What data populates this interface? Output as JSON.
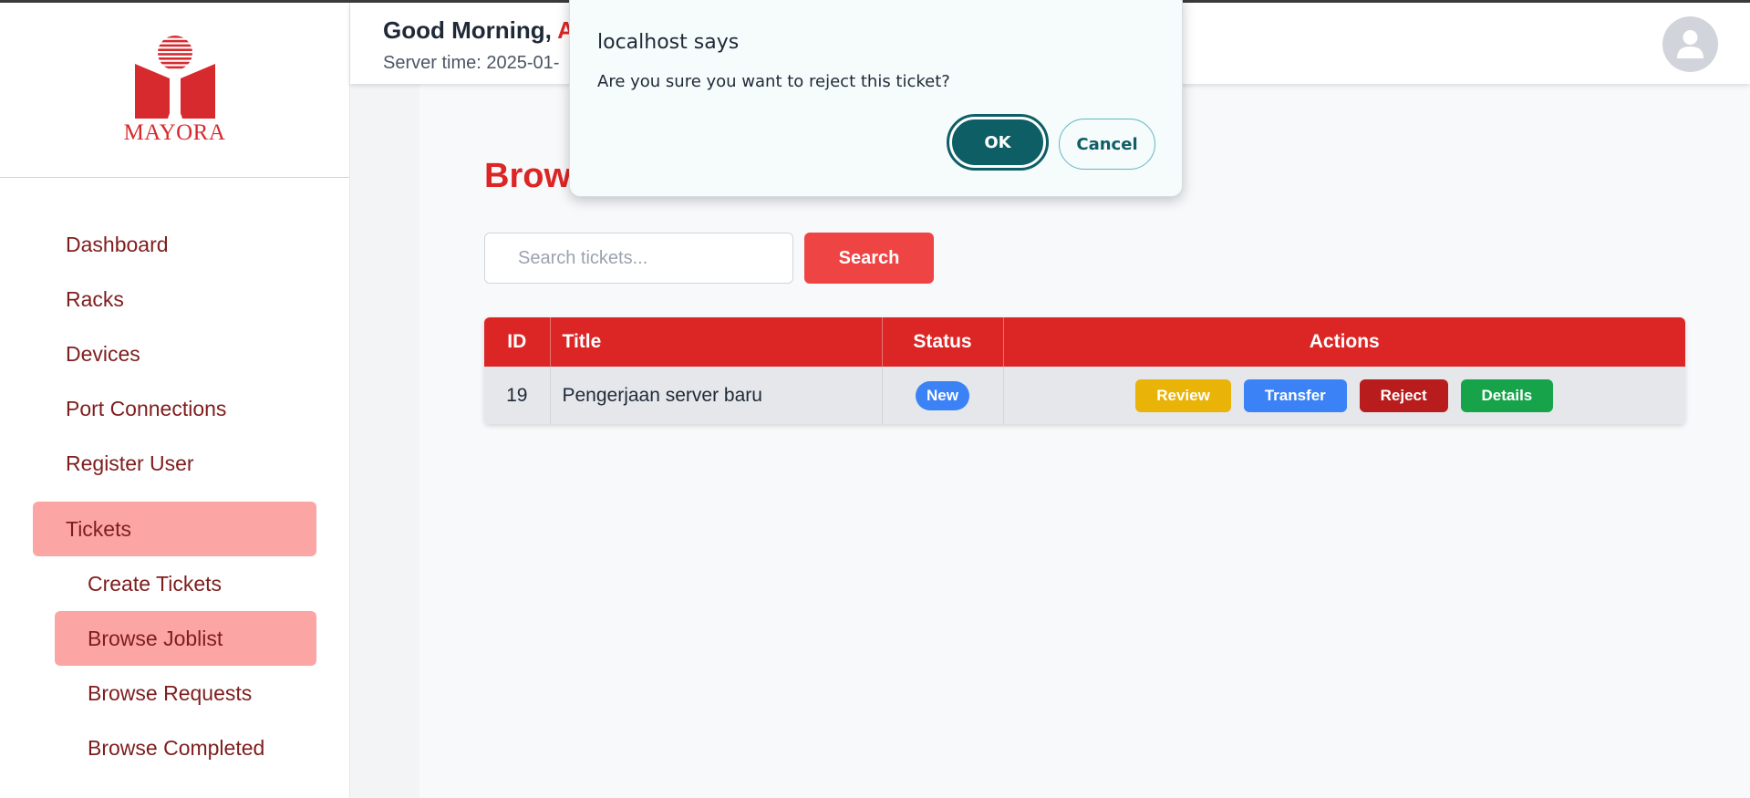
{
  "brand": {
    "name": "MAYORA",
    "color": "#d62a2f"
  },
  "header": {
    "greeting": "Good Morning,",
    "user_name": "A",
    "server_time": "Server time: 2025-01-"
  },
  "sidebar": {
    "items": [
      {
        "label": "Dashboard",
        "active": false
      },
      {
        "label": "Racks",
        "active": false
      },
      {
        "label": "Devices",
        "active": false
      },
      {
        "label": "Port Connections",
        "active": false
      },
      {
        "label": "Register User",
        "active": false
      },
      {
        "label": "Tickets",
        "active": true
      },
      {
        "label": "Create Tickets",
        "active": false,
        "sub": true
      },
      {
        "label": "Browse Joblist",
        "active": true,
        "sub": true
      },
      {
        "label": "Browse Requests",
        "active": false,
        "sub": true
      },
      {
        "label": "Browse Completed",
        "active": false,
        "sub": true
      }
    ]
  },
  "main": {
    "title": "Brows",
    "search": {
      "placeholder": "Search tickets...",
      "value": "",
      "button": "Search"
    },
    "table": {
      "headers": [
        "ID",
        "Title",
        "Status",
        "Actions"
      ],
      "rows": [
        {
          "id": "19",
          "title": "Pengerjaan server baru",
          "status": "New",
          "actions": [
            "Review",
            "Transfer",
            "Reject",
            "Details"
          ]
        }
      ]
    }
  },
  "dialog": {
    "title": "localhost says",
    "message": "Are you sure you want to reject this ticket?",
    "ok": "OK",
    "cancel": "Cancel"
  },
  "colors": {
    "primary_red": "#dc2626",
    "sidebar_active": "#fca5a5",
    "dialog_accent": "#0e5e66"
  }
}
